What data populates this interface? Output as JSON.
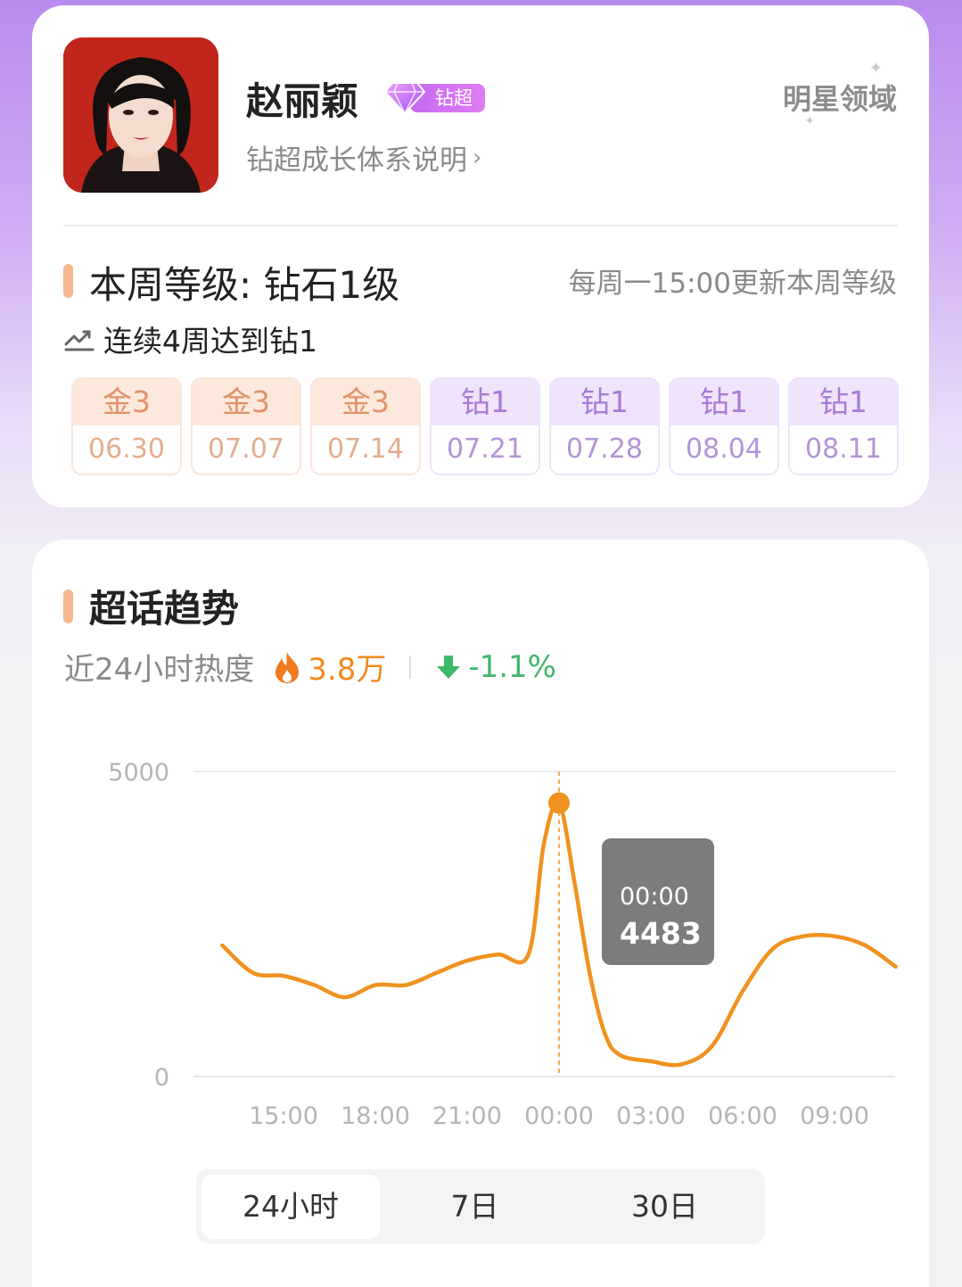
{
  "profile": {
    "name": "赵丽颖",
    "badge_label": "钻超",
    "subtitle": "钻超成长体系说明",
    "domain_link": "明星领域"
  },
  "level": {
    "title": "本周等级: 钻石1级",
    "update_note": "每周一15:00更新本周等级",
    "streak": "连续4周达到钻1",
    "weeks": [
      {
        "level": "金3",
        "date": "06.30",
        "tier": "gold"
      },
      {
        "level": "金3",
        "date": "07.07",
        "tier": "gold"
      },
      {
        "level": "金3",
        "date": "07.14",
        "tier": "gold"
      },
      {
        "level": "钻1",
        "date": "07.21",
        "tier": "diamond"
      },
      {
        "level": "钻1",
        "date": "07.28",
        "tier": "diamond"
      },
      {
        "level": "钻1",
        "date": "08.04",
        "tier": "diamond"
      },
      {
        "level": "钻1",
        "date": "08.11",
        "tier": "diamond"
      }
    ]
  },
  "trend": {
    "title": "超话趋势",
    "heat_label": "近24小时热度",
    "heat_value": "3.8万",
    "change": "-1.1%",
    "tabs": [
      "24小时",
      "7日",
      "30日"
    ],
    "active_tab": "24小时"
  },
  "colors": {
    "line": "#f0921f",
    "accent_bar": "#f6b78f",
    "up_down_green": "#3fb86a"
  },
  "chart_data": {
    "type": "line",
    "x": [
      "13:00",
      "14:00",
      "15:00",
      "16:00",
      "17:00",
      "18:00",
      "19:00",
      "20:00",
      "21:00",
      "22:00",
      "23:00",
      "23:30",
      "00:00",
      "00:30",
      "01:00",
      "01:30",
      "02:00",
      "03:00",
      "04:00",
      "05:00",
      "06:00",
      "07:00",
      "08:00",
      "09:00",
      "10:00",
      "11:00"
    ],
    "values": [
      2150,
      1700,
      1650,
      1500,
      1300,
      1500,
      1500,
      1700,
      1900,
      2000,
      2000,
      3800,
      4483,
      3200,
      1700,
      700,
      350,
      250,
      200,
      500,
      1400,
      2100,
      2300,
      2300,
      2150,
      1800
    ],
    "ylim": [
      0,
      5000
    ],
    "y_ticks": [
      "5000",
      "0"
    ],
    "x_ticks": [
      "15:00",
      "18:00",
      "21:00",
      "00:00",
      "03:00",
      "06:00",
      "09:00"
    ],
    "tooltip": {
      "time": "00:00",
      "value": "4483"
    },
    "grid": true
  }
}
